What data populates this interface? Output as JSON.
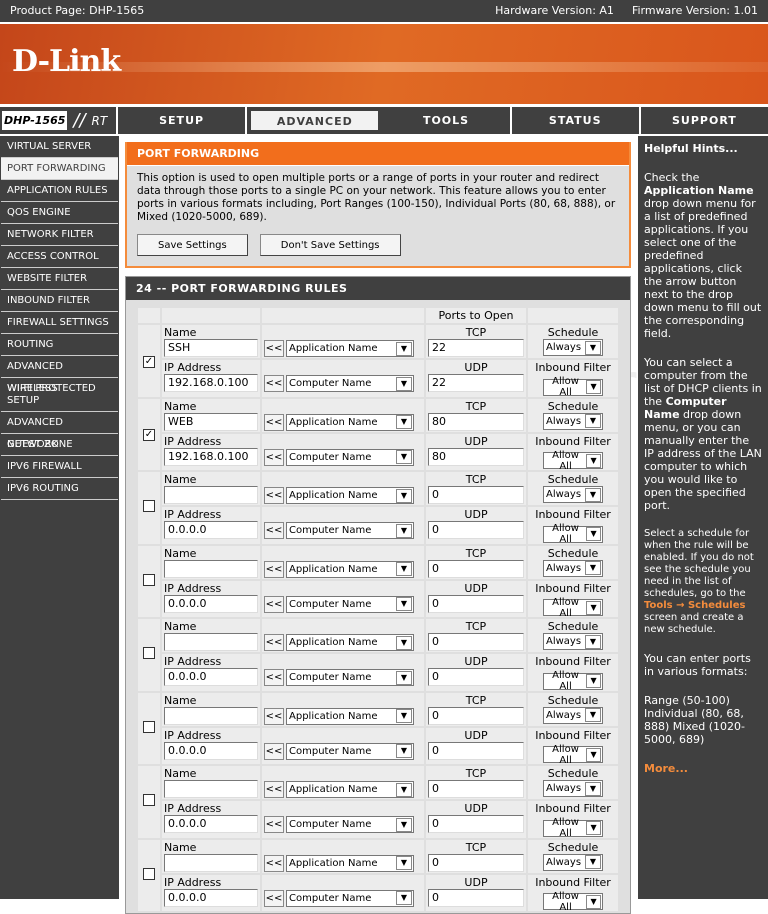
{
  "topbar": {
    "product": "Product Page: DHP-1565",
    "hardware": "Hardware Version: A1",
    "firmware": "Firmware Version: 1.01"
  },
  "logo": "D-Link",
  "brand_color": "#f26e1c",
  "nav": {
    "model": "DHP-1565",
    "slashes": "//",
    "suffix": "RT",
    "tabs": [
      "SETUP",
      "ADVANCED",
      "TOOLS",
      "STATUS",
      "SUPPORT"
    ],
    "active": "ADVANCED"
  },
  "sidebar": {
    "items": [
      "VIRTUAL SERVER",
      "PORT FORWARDING",
      "APPLICATION RULES",
      "QOS ENGINE",
      "NETWORK FILTER",
      "ACCESS CONTROL",
      "WEBSITE FILTER",
      "INBOUND FILTER",
      "FIREWALL SETTINGS",
      "ROUTING",
      "ADVANCED WIRELESS",
      "WI-FI PROTECTED SETUP",
      "ADVANCED NETWORK",
      "GUEST ZONE",
      "IPV6 FIREWALL",
      "IPV6 ROUTING"
    ],
    "active": "PORT FORWARDING"
  },
  "intro": {
    "title": "PORT FORWARDING",
    "text": "This option is used to open multiple ports or a range of ports in your router and redirect data through those ports to a single PC on your network. This feature allows you to enter ports in various formats including, Port Ranges (100-150), Individual Ports (80, 68, 888), or Mixed (1020-5000, 689).",
    "save": "Save Settings",
    "dont_save": "Don't Save Settings"
  },
  "rules": {
    "title": "24 -- PORT FORWARDING RULES",
    "ports_header": "Ports to Open",
    "labels": {
      "name": "Name",
      "ip": "IP Address",
      "tcp": "TCP",
      "udp": "UDP",
      "schedule": "Schedule",
      "inbound": "Inbound Filter",
      "app": "Application Name",
      "computer": "Computer Name",
      "arrow": "<<"
    },
    "items": [
      {
        "checked": true,
        "name": "SSH",
        "ip": "192.168.0.100",
        "tcp": "22",
        "udp": "22",
        "schedule": "Always",
        "inbound": "Allow All"
      },
      {
        "checked": true,
        "name": "WEB",
        "ip": "192.168.0.100",
        "tcp": "80",
        "udp": "80",
        "schedule": "Always",
        "inbound": "Allow All"
      },
      {
        "checked": false,
        "name": "",
        "ip": "0.0.0.0",
        "tcp": "0",
        "udp": "0",
        "schedule": "Always",
        "inbound": "Allow All"
      },
      {
        "checked": false,
        "name": "",
        "ip": "0.0.0.0",
        "tcp": "0",
        "udp": "0",
        "schedule": "Always",
        "inbound": "Allow All"
      },
      {
        "checked": false,
        "name": "",
        "ip": "0.0.0.0",
        "tcp": "0",
        "udp": "0",
        "schedule": "Always",
        "inbound": "Allow All"
      },
      {
        "checked": false,
        "name": "",
        "ip": "0.0.0.0",
        "tcp": "0",
        "udp": "0",
        "schedule": "Always",
        "inbound": "Allow All"
      },
      {
        "checked": false,
        "name": "",
        "ip": "0.0.0.0",
        "tcp": "0",
        "udp": "0",
        "schedule": "Always",
        "inbound": "Allow All"
      },
      {
        "checked": false,
        "name": "",
        "ip": "0.0.0.0",
        "tcp": "0",
        "udp": "0",
        "schedule": "Always",
        "inbound": "Allow All"
      }
    ]
  },
  "hints": {
    "title": "Helpful Hints...",
    "p1a": "Check the ",
    "p1b": "Application Name",
    "p1c": " drop down menu for a list of predefined applications. If you select one of the predefined applications, click the arrow button next to the drop down menu to fill out the corresponding field.",
    "p2a": "You can select a computer from the list of DHCP clients in the ",
    "p2b": "Computer Name",
    "p2c": " drop down menu, or you can manually enter the IP address of the LAN computer to which you would like to open the specified port.",
    "p3a": "Select a schedule for when the rule will be enabled. If you do not see the schedule you need in the list of schedules, go to the ",
    "p3b": "Tools → Schedules",
    "p3c": " screen and create a new schedule.",
    "p4": "You can enter ports in various formats:",
    "p5": "Range (50-100) Individual (80, 68, 888) Mixed (1020-5000, 689)",
    "more": "More..."
  },
  "watermark": "setuprouter"
}
